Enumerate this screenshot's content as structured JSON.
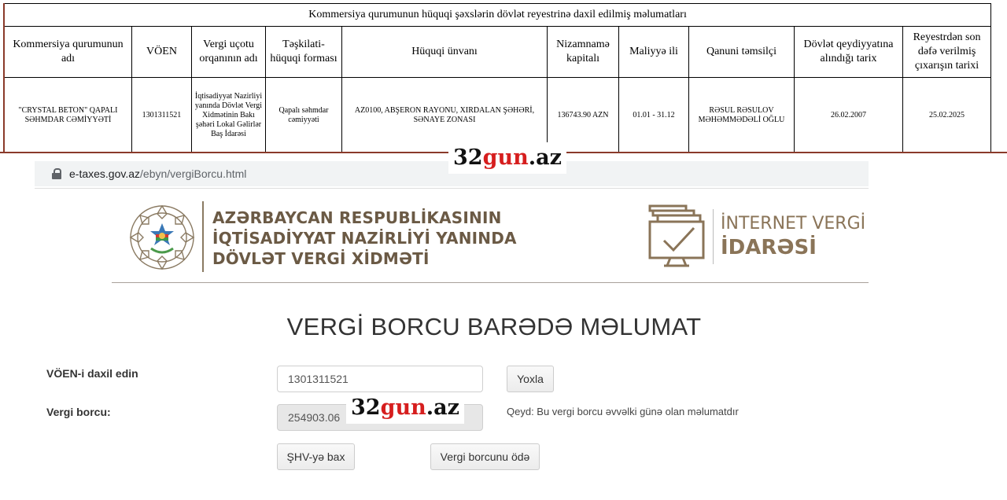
{
  "registry": {
    "caption": "Kommersiya qurumunun hüquqi şəxslərin dövlət reyestrinə daxil edilmiş məlumatları",
    "columns": [
      "Kommersiya qurumunun adı",
      "VÖEN",
      "Vergi uçotu orqanının adı",
      "Təşkilati-hüquqi forması",
      "Hüquqi ünvanı",
      "Nizamnamə kapitalı",
      "Maliyyə ili",
      "Qanuni təmsilçi",
      "Dövlət qeydiyyatına alındığı tarix",
      "Reyestrdən son dəfə verilmiş çıxarışın tarixi"
    ],
    "row": [
      "\"CRYSTAL BETON\" QAPALI SƏHMDAR CƏMİYYƏTİ",
      "1301311521",
      "İqtisadiyyat Nazirliyi yanında Dövlət Vergi Xidmətinin Bakı şəhəri Lokal Gəlirlər Baş İdarəsi",
      "Qapalı səhmdar cəmiyyəti",
      "AZ0100, ABŞERON RAYONU, XIRDALAN ŞƏHƏRİ, SƏNAYE ZONASI",
      "136743.90 AZN",
      "01.01 - 31.12",
      "RƏSUL RƏSULOV MƏHƏMMƏDƏLİ OĞLU",
      "26.02.2007",
      "25.02.2025"
    ]
  },
  "watermark": {
    "part1": "32",
    "part2": "gun",
    "part3": ".az"
  },
  "browser": {
    "url_domain": "e-taxes.gov.az",
    "url_path": "/ebyn/vergiBorcu.html",
    "lock_icon": "lock-icon"
  },
  "header": {
    "ministry_line1": "AZƏRBAYCAN RESPUBLİKASININ",
    "ministry_line2": "İQTİSADİYYAT NAZİRLİYİ YANINDA",
    "ministry_line3": "DÖVLƏT VERGİ XİDMƏTİ",
    "ivi_line1": "İNTERNET VERGİ",
    "ivi_line2": "İDARƏSİ",
    "brand_color": "#6b5a45"
  },
  "page": {
    "title": "VERGİ BORCU BARƏDƏ MƏLUMAT",
    "voen_label": "VÖEN-i daxil edin",
    "voen_value": "1301311521",
    "check_button": "Yoxla",
    "debt_label": "Vergi borcu:",
    "debt_value": "254903.06",
    "note": "Qeyd: Bu vergi borcu əvvəlki günə olan məlumatdır",
    "shv_button": "ŞHV-yə bax",
    "pay_button": "Vergi borcunu ödə"
  }
}
